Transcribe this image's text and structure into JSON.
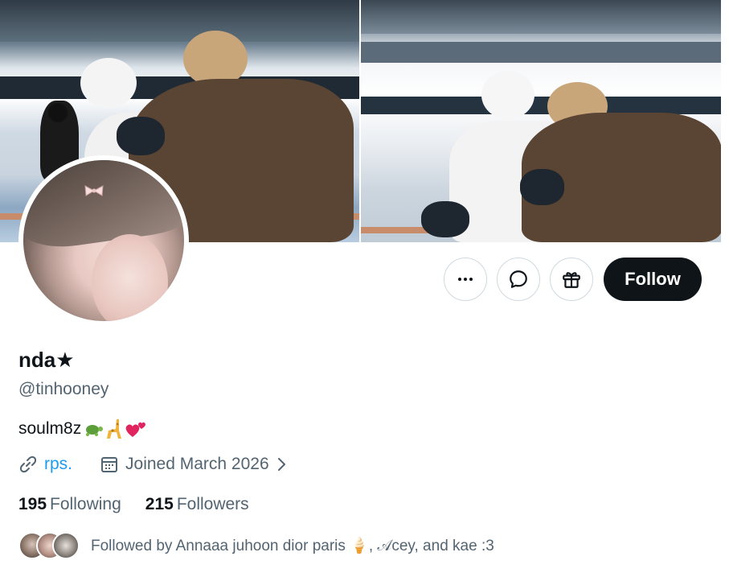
{
  "profile": {
    "display_name": "nda★",
    "handle": "@tinhooney",
    "bio": "soulm8z",
    "bio_emojis": [
      "turtle",
      "giraffe",
      "two-hearts"
    ],
    "link_text": "rps.",
    "joined": "Joined March 2026",
    "following_count": "195",
    "following_label": "Following",
    "followers_count": "215",
    "followers_label": "Followers",
    "followed_by": "Followed by Annaaa juhoon dior paris 🍦, 𝒜cey, and kae :3"
  },
  "actions": {
    "follow_label": "Follow",
    "more_icon": "more-horizontal-icon",
    "message_icon": "message-icon",
    "gift_icon": "gift-icon"
  },
  "colors": {
    "accent": "#1d9bf0",
    "text_primary": "#0f1419",
    "text_secondary": "#536471",
    "follow_bg": "#0f1419",
    "border": "#cfd9de"
  }
}
